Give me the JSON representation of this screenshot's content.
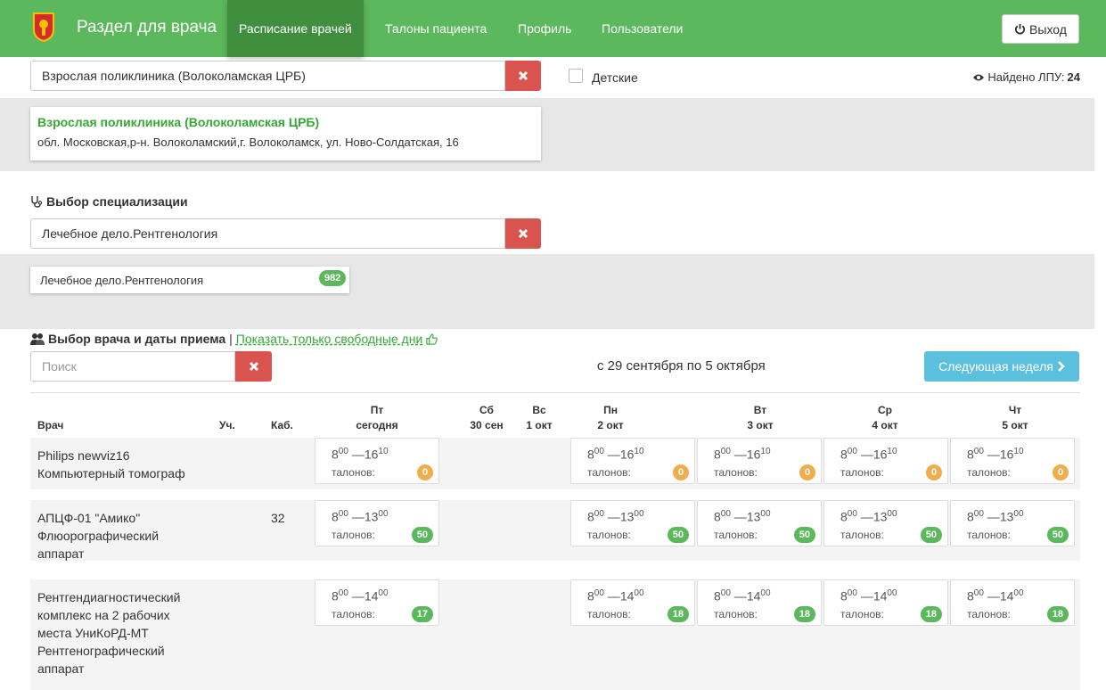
{
  "navbar": {
    "brand": "Раздел для врача",
    "items": [
      "Расписание врачей",
      "Талоны пациента",
      "Профиль",
      "Пользователи"
    ],
    "logout": "Выход"
  },
  "clinic": {
    "input_value": "Взрослая поликлиника (Волоколамская ЦРБ)",
    "children_label": "Детские",
    "found_label": "Найдено ЛПУ:",
    "found_count": "24",
    "result_name": "Взрослая поликлиника (Волоколамская ЦРБ)",
    "result_address": "обл. Московская,р-н. Волоколамский,г. Волоколамск, ул. Ново-Солдатская, 16"
  },
  "specialization": {
    "title": "Выбор специализации",
    "input_value": "Лечебное дело.Рентгенология",
    "result_name": "Лечебное дело.Рентгенология",
    "result_count": "982"
  },
  "doctor": {
    "title": "Выбор врача и даты приема",
    "separator": "|",
    "filter_link": "Показать только свободные дни",
    "search_placeholder": "Поиск",
    "week_label": "с 29 сентября по 5 октября",
    "next_week": "Следующая неделя"
  },
  "table": {
    "headers": {
      "doctor": "Врач",
      "area": "Уч.",
      "room": "Каб.",
      "days": [
        {
          "d": "Пт",
          "date": "сегодня"
        },
        {
          "d": "Сб",
          "date": "30 сен"
        },
        {
          "d": "Вс",
          "date": "1 окт"
        },
        {
          "d": "Пн",
          "date": "2 окт"
        },
        {
          "d": "Вт",
          "date": "3 окт"
        },
        {
          "d": "Ср",
          "date": "4 окт"
        },
        {
          "d": "Чт",
          "date": "5 окт"
        }
      ]
    },
    "slot_label": "талонов:",
    "rows": [
      {
        "lines": [
          "Philips newviz16",
          "Компьютерный томограф"
        ],
        "room": "",
        "start_h": "8",
        "start_m": "00",
        "end_h": "16",
        "end_m": "10",
        "counts": [
          "0",
          "",
          "",
          "0",
          "0",
          "0",
          "0"
        ],
        "color": "orange"
      },
      {
        "lines": [
          "АПЦФ-01 \"Амико\"",
          "Флюорографический",
          "аппарат"
        ],
        "room": "32",
        "start_h": "8",
        "start_m": "00",
        "end_h": "13",
        "end_m": "00",
        "counts": [
          "50",
          "",
          "",
          "50",
          "50",
          "50",
          "50"
        ],
        "color": "green"
      },
      {
        "lines": [
          "Рентгендиагностический",
          "комплекс на 2 рабочих",
          "места УниКоРД-МТ",
          "Рентгенографический",
          "аппарат"
        ],
        "room": "",
        "start_h": "8",
        "start_m": "00",
        "end_h": "14",
        "end_m": "00",
        "counts": [
          "17",
          "",
          "",
          "18",
          "18",
          "18",
          "18"
        ],
        "color": "green"
      }
    ]
  }
}
